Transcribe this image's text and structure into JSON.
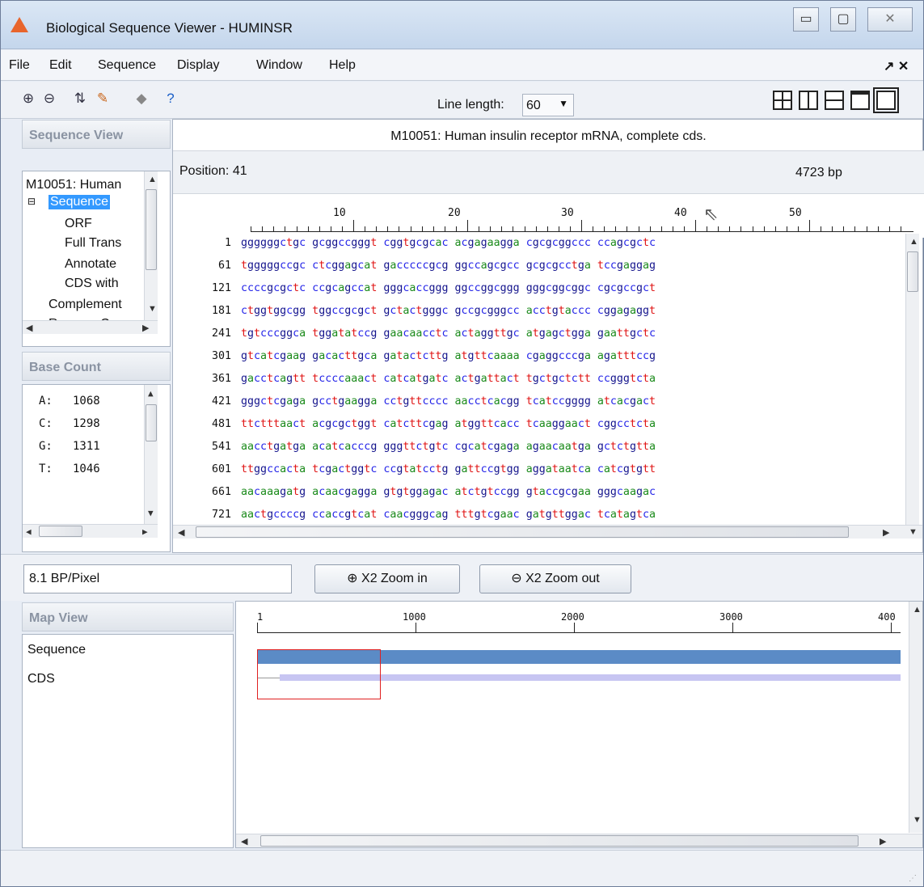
{
  "window": {
    "title": "Biological Sequence Viewer - HUMINSR",
    "min": "▭",
    "max": "▢",
    "close": "✕"
  },
  "menu": {
    "items": [
      "File",
      "Edit",
      "Sequence",
      "Display",
      "Window",
      "Help"
    ],
    "dock": "↗ ✕"
  },
  "toolbar": {
    "line_length_label": "Line length:",
    "line_length_value": "60",
    "icons": [
      "zoom-in-icon",
      "zoom-out-icon",
      "translate-icon",
      "annotate-icon",
      "eraser-icon",
      "help-icon"
    ]
  },
  "sequence_view": {
    "header": "Sequence View",
    "tree": [
      "M10051: Human",
      "Sequence",
      "ORF",
      "Full Trans",
      "Annotate",
      "CDS with",
      "Complement",
      "Reverse Com"
    ]
  },
  "base_count": {
    "header": "Base Count",
    "rows": [
      {
        "base": "A:",
        "count": "1068"
      },
      {
        "base": "C:",
        "count": "1298"
      },
      {
        "base": "G:",
        "count": "1311"
      },
      {
        "base": "T:",
        "count": "1046"
      }
    ]
  },
  "main": {
    "title": "M10051: Human insulin receptor mRNA, complete cds.",
    "position": "Position: 41",
    "length": "4723 bp",
    "ruler": [
      "10",
      "20",
      "30",
      "40",
      "50"
    ],
    "rows": [
      {
        "n": "1",
        "s": "ggggggctgc gcggccgggt cggtgcgcac acgagaagga cgcgcggccc ccagcgctc"
      },
      {
        "n": "61",
        "s": "tgggggccgc ctcggagcat gacccccgcg ggccagcgcc gcgcgcctga tccgaggag"
      },
      {
        "n": "121",
        "s": "ccccgcgctc ccgcagccat gggcaccggg ggccggcggg gggcggcggc cgcgccgct"
      },
      {
        "n": "181",
        "s": "ctggtggcgg tggccgcgct gctactgggc gccgcgggcc acctgtaccc cggagaggt"
      },
      {
        "n": "241",
        "s": "tgtcccggca tggatatccg gaacaacctc actaggttgc atgagctgga gaattgctc"
      },
      {
        "n": "301",
        "s": "gtcatcgaag gacacttgca gatactcttg atgttcaaaa cgaggcccga agatttccg"
      },
      {
        "n": "361",
        "s": "gacctcagtt tccccaaact catcatgatc actgattact tgctgctctt ccgggtcta"
      },
      {
        "n": "421",
        "s": "gggctcgaga gcctgaagga cctgttcccc aacctcacgg tcatccgggg atcacgact"
      },
      {
        "n": "481",
        "s": "ttctttaact acgcgctggt catcttcgag atggttcacc tcaaggaact cggcctcta"
      },
      {
        "n": "541",
        "s": "aacctgatga acatcacccg gggttctgtc cgcatcgaga agaacaatga gctctgtta"
      },
      {
        "n": "601",
        "s": "ttggccacta tcgactggtc ccgtatcctg gattccgtgg aggataatca catcgtgtt"
      },
      {
        "n": "661",
        "s": "aacaaagatg acaacgagga gtgtggagac atctgtccgg gtaccgcgaa gggcaagac"
      },
      {
        "n": "721",
        "s": "aactgccccg ccaccgtcat caacgggcag tttgtcgaac gatgttggac tcatagtca"
      }
    ]
  },
  "zoom": {
    "bp_per_pixel": "8.1 BP/Pixel",
    "zoom_in": "X2 Zoom in",
    "zoom_out": "X2 Zoom out"
  },
  "map_view": {
    "header": "Map View",
    "tracks": [
      "Sequence",
      "CDS"
    ],
    "ruler": [
      "1",
      "1000",
      "2000",
      "3000",
      "400"
    ],
    "colors": {
      "sequence": "#5b8bc6",
      "cds": "#c7c5f2",
      "window": "#e02020"
    }
  }
}
